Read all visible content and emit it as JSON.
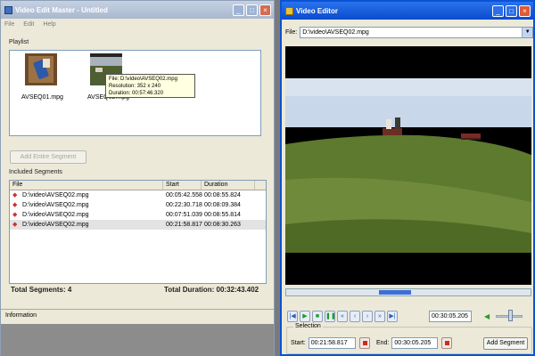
{
  "left_window": {
    "title": "Video Edit Master - Untitled",
    "menu": [
      "File",
      "Edit",
      "Help"
    ],
    "playlist_label": "Playlist",
    "playlist_items": [
      {
        "label": "AVSEQ01.mpg"
      },
      {
        "label": "AVSEQ02.mpg"
      }
    ],
    "tooltip": {
      "file": "File: D:\\video\\AVSEQ02.mpg",
      "resolution": "Resolution: 352 x 240",
      "duration": "Duration: 00:57:46.320"
    },
    "add_button": "Add Entire Segment",
    "included_label": "Included Segments",
    "columns": {
      "file": "File",
      "start": "Start",
      "duration": "Duration"
    },
    "segments": [
      {
        "file": "D:\\video\\AVSEQ02.mpg",
        "start": "00:05:42.558",
        "duration": "00:08:55.824"
      },
      {
        "file": "D:\\video\\AVSEQ02.mpg",
        "start": "00:22:30.718",
        "duration": "00:08:09.384"
      },
      {
        "file": "D:\\video\\AVSEQ02.mpg",
        "start": "00:07:51.039",
        "duration": "00:08:55.814"
      },
      {
        "file": "D:\\video\\AVSEQ02.mpg",
        "start": "00:21:58.817",
        "duration": "00:08:30.263"
      }
    ],
    "total_segments_label": "Total Segments:",
    "total_segments_value": "4",
    "total_duration_label": "Total Duration:",
    "total_duration_value": "00:32:43.402",
    "status": "Information"
  },
  "right_window": {
    "title": "Video Editor",
    "file_label": "File:",
    "file_value": "D:\\video\\AVSEQ02.mpg",
    "time_display": "00:30:05.205",
    "selection_label": "Selection",
    "start_label": "Start:",
    "start_value": "00:21:58.817",
    "end_label": "End:",
    "end_value": "00:30:05.205",
    "add_segment": "Add Segment",
    "seek_position_fraction": 0.55,
    "selection_fraction": [
      0.38,
      0.51
    ],
    "volume_fraction": 0.5
  },
  "colors": {
    "xp_blue": "#0a53d5",
    "inactive_title": "#a9b8cf",
    "face": "#ece9d8",
    "grass": "#5d7a2e",
    "sky": "#c8d7ea"
  }
}
